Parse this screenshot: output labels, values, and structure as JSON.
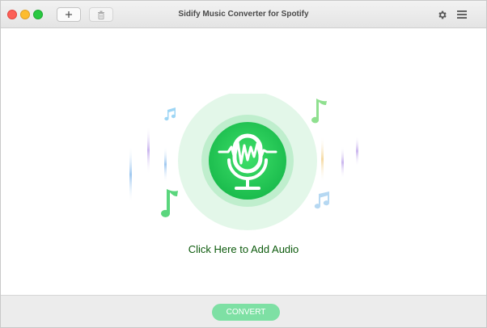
{
  "window": {
    "title": "Sidify Music Converter for Spotify"
  },
  "toolbar": {
    "add_icon": "plus-icon",
    "delete_icon": "trash-icon",
    "settings_icon": "gear-icon",
    "menu_icon": "hamburger-menu-icon"
  },
  "main": {
    "add_audio_label": "Click Here to Add Audio",
    "center_icon": "microphone-waveform-icon"
  },
  "footer": {
    "convert_label": "CONVERT"
  },
  "colors": {
    "accent_green": "#22c55e",
    "halo_green": "#d8f5e2",
    "label_green": "#0c5a0c",
    "convert_button": "#7ee0a4"
  }
}
